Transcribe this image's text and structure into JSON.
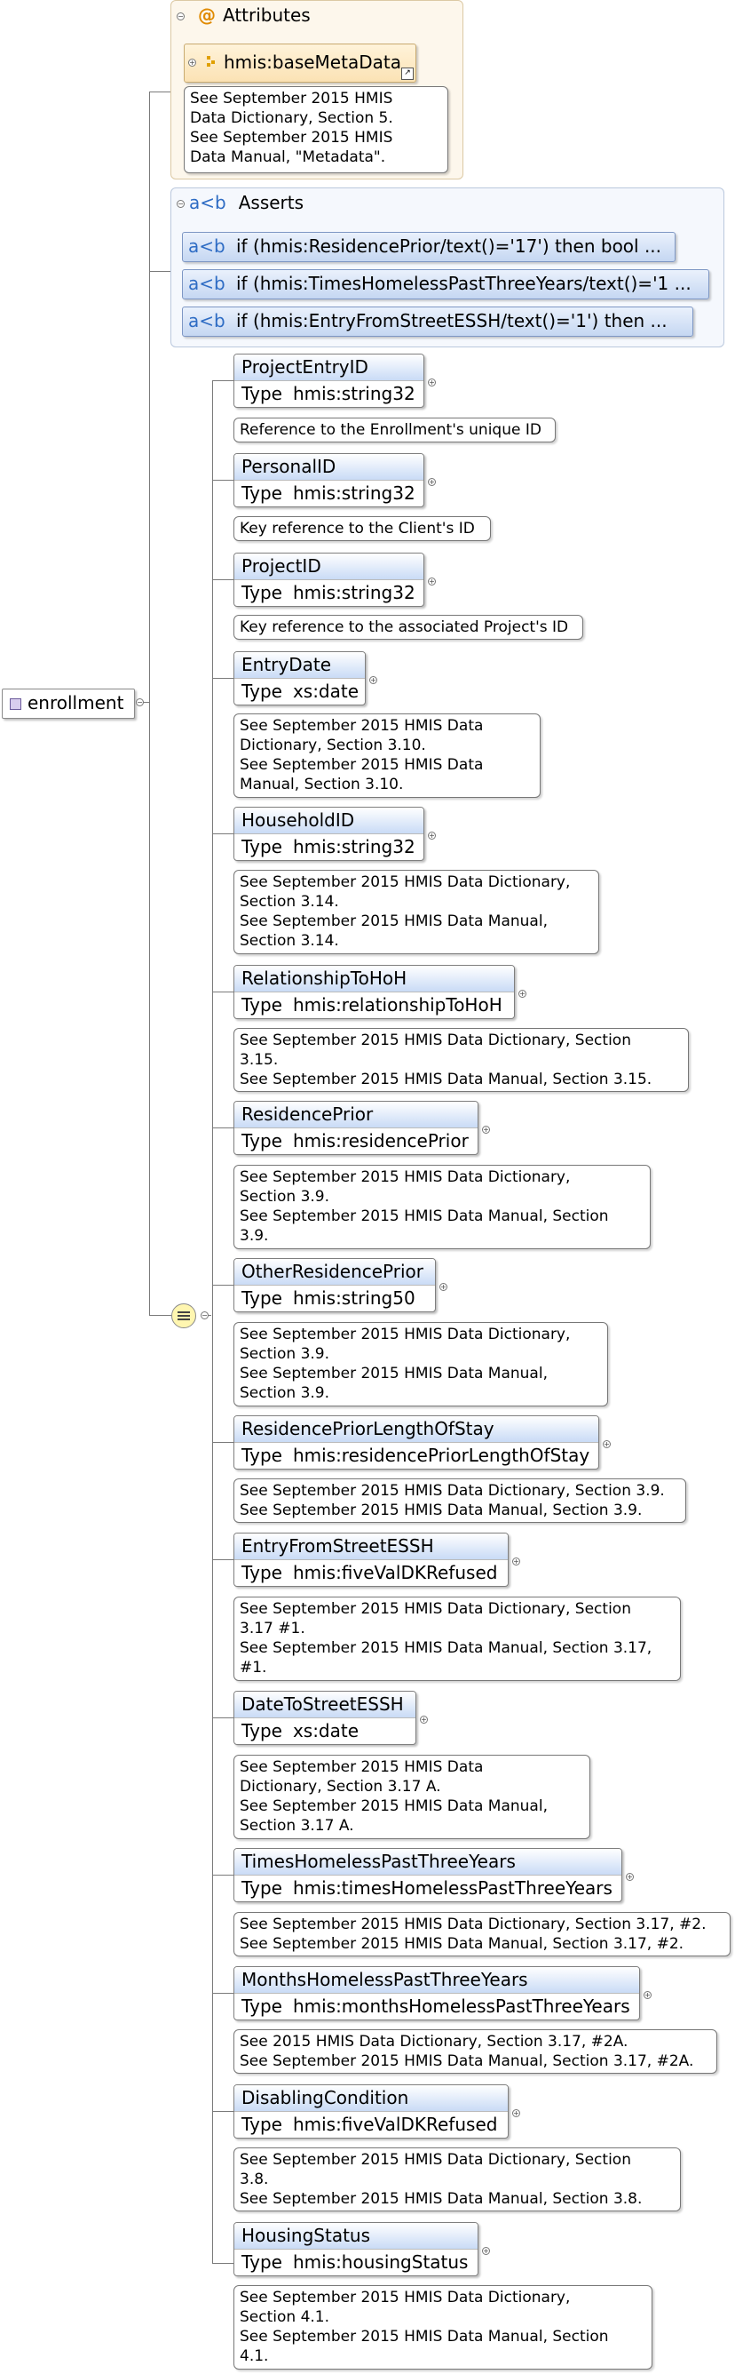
{
  "root": {
    "label": "enrollment"
  },
  "attributes": {
    "header": "Attributes",
    "item": "hmis:baseMetaData",
    "doc": "See September 2015 HMIS\nData Dictionary, Section 5.\nSee September 2015 HMIS\nData Manual, \"Metadata\"."
  },
  "asserts": {
    "header": "Asserts",
    "items": [
      "if (hmis:ResidencePrior/text()='17') then bool ...",
      "if (hmis:TimesHomelessPastThreeYears/text()='1 ...",
      "if (hmis:EntryFromStreetESSH/text()='1') then  ..."
    ]
  },
  "type_label": "Type",
  "elements": [
    {
      "name": "ProjectEntryID",
      "type": "hmis:string32",
      "doc": "Reference to the Enrollment's unique ID"
    },
    {
      "name": "PersonalID",
      "type": "hmis:string32",
      "doc": "Key reference to the Client's ID"
    },
    {
      "name": "ProjectID",
      "type": "hmis:string32",
      "doc": "Key reference to the associated Project's ID"
    },
    {
      "name": "EntryDate",
      "type": "xs:date",
      "doc": "See September 2015 HMIS Data\nDictionary, Section 3.10.\nSee September 2015 HMIS Data\nManual, Section 3.10."
    },
    {
      "name": "HouseholdID",
      "type": "hmis:string32",
      "doc": "See September 2015 HMIS Data Dictionary,\nSection 3.14.\nSee September 2015 HMIS Data Manual,\nSection 3.14."
    },
    {
      "name": "RelationshipToHoH",
      "type": "hmis:relationshipToHoH",
      "doc": "See September 2015 HMIS Data Dictionary, Section\n3.15.\nSee September 2015 HMIS Data Manual, Section 3.15."
    },
    {
      "name": "ResidencePrior",
      "type": "hmis:residencePrior",
      "doc": "See September 2015 HMIS Data Dictionary,\nSection 3.9.\nSee September 2015 HMIS Data Manual, Section\n3.9."
    },
    {
      "name": "OtherResidencePrior",
      "type": "hmis:string50",
      "doc": "See September 2015 HMIS Data Dictionary,\nSection 3.9.\nSee September 2015 HMIS Data Manual,\nSection 3.9."
    },
    {
      "name": "ResidencePriorLengthOfStay",
      "type": "hmis:residencePriorLengthOfStay",
      "doc": "See September 2015 HMIS Data Dictionary, Section 3.9.\nSee September 2015 HMIS Data Manual, Section 3.9."
    },
    {
      "name": "EntryFromStreetESSH",
      "type": "hmis:fiveValDKRefused",
      "doc": "See September 2015 HMIS Data Dictionary, Section\n3.17 #1.\nSee September 2015 HMIS Data Manual, Section 3.17,\n#1."
    },
    {
      "name": "DateToStreetESSH",
      "type": "xs:date",
      "doc": "See September 2015 HMIS Data\nDictionary, Section 3.17 A.\nSee September 2015 HMIS Data Manual,\nSection 3.17 A."
    },
    {
      "name": "TimesHomelessPastThreeYears",
      "type": "hmis:timesHomelessPastThreeYears",
      "doc": "See September 2015 HMIS Data Dictionary, Section 3.17, #2.\nSee September 2015 HMIS Data Manual, Section 3.17, #2."
    },
    {
      "name": "MonthsHomelessPastThreeYears",
      "type": "hmis:monthsHomelessPastThreeYears",
      "doc": "See 2015 HMIS Data Dictionary, Section 3.17, #2A.\nSee September 2015 HMIS Data Manual, Section 3.17, #2A."
    },
    {
      "name": "DisablingCondition",
      "type": "hmis:fiveValDKRefused",
      "doc": "See September 2015 HMIS Data Dictionary, Section\n3.8.\nSee September 2015 HMIS Data Manual, Section 3.8."
    },
    {
      "name": "HousingStatus",
      "type": "hmis:housingStatus",
      "doc": "See September 2015 HMIS Data Dictionary,\nSection 4.1.\nSee September 2015 HMIS Data Manual, Section\n4.1."
    }
  ]
}
